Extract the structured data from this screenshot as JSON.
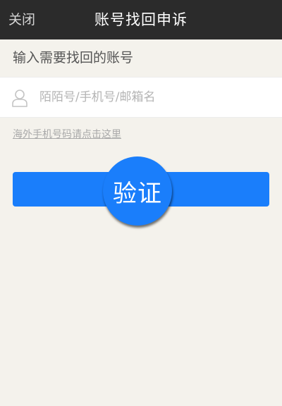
{
  "nav": {
    "close_label": "关闭",
    "title": "账号找回申诉"
  },
  "form": {
    "section_title": "输入需要找回的账号",
    "account_placeholder": "陌陌号/手机号/邮箱名",
    "account_icon": "user-icon",
    "overseas_link": "海外手机号码请点击这里",
    "verify_label": "验证"
  },
  "colors": {
    "nav_background": "#2b2b2b",
    "page_background": "#f4f2ec",
    "accent": "#1a7efb"
  }
}
